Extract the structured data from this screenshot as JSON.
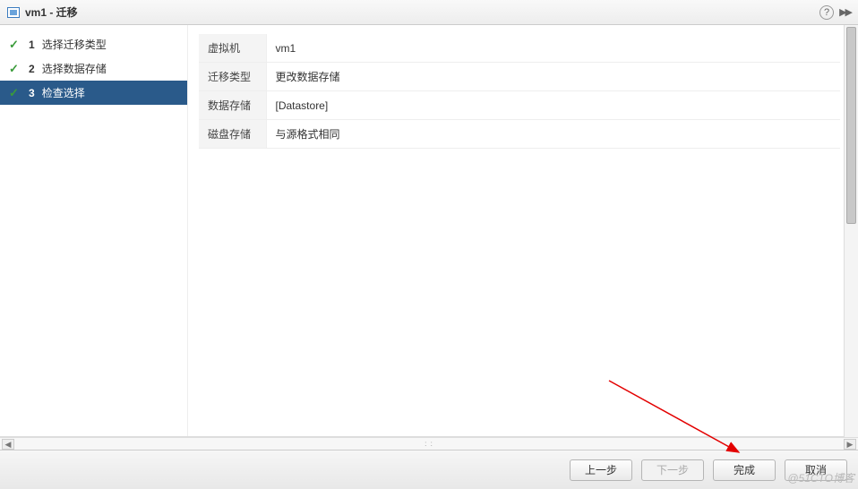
{
  "titlebar": {
    "title": "vm1 - 迁移",
    "help_tooltip": "?",
    "expand_glyph": "▶▶"
  },
  "sidebar": {
    "steps": [
      {
        "num": "1",
        "label": "选择迁移类型",
        "checked": true,
        "active": false
      },
      {
        "num": "2",
        "label": "选择数据存储",
        "checked": true,
        "active": false
      },
      {
        "num": "3",
        "label": "检查选择",
        "checked": true,
        "active": true
      }
    ]
  },
  "summary": {
    "rows": [
      {
        "label": "虚拟机",
        "value": "vm1"
      },
      {
        "label": "迁移类型",
        "value": "更改数据存储"
      },
      {
        "label": "数据存储",
        "value": "[Datastore]"
      },
      {
        "label": "磁盘存储",
        "value": "与源格式相同"
      }
    ]
  },
  "footer": {
    "back": "上一步",
    "next": "下一步",
    "finish": "完成",
    "cancel": "取消"
  },
  "watermark": "@51CTO博客"
}
